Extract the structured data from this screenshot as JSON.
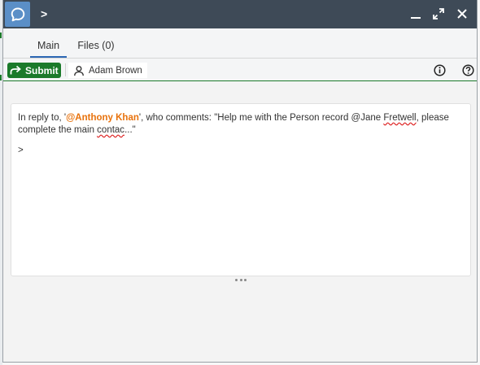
{
  "window": {
    "title": ">",
    "controls": {
      "minimize_icon": "minimize-icon",
      "expand_icon": "expand-icon",
      "close_icon": "close-icon"
    }
  },
  "tabs": [
    {
      "label": "Main",
      "active": true
    },
    {
      "label": "Files (0)",
      "active": false
    }
  ],
  "toolbar": {
    "submit_label": "Submit",
    "assignee_name": "Adam Brown",
    "info_icon": "info-icon",
    "help_icon": "help-icon"
  },
  "editor": {
    "reply_prefix": "In reply to, '",
    "mention": "@Anthony Khan",
    "reply_mid": "', who comments: \"Help me with the Person record @Jane ",
    "word_fretwell": "Fretwell",
    "reply_mid2": ", please complete the main ",
    "word_contac": "contac",
    "reply_suffix": "...\"",
    "current_line": ">"
  },
  "colors": {
    "titlebar": "#3e4a57",
    "app_icon": "#5b8fc7",
    "submit": "#1b7a2a",
    "active_tab": "#2c67b4",
    "mention": "#e8720c"
  }
}
